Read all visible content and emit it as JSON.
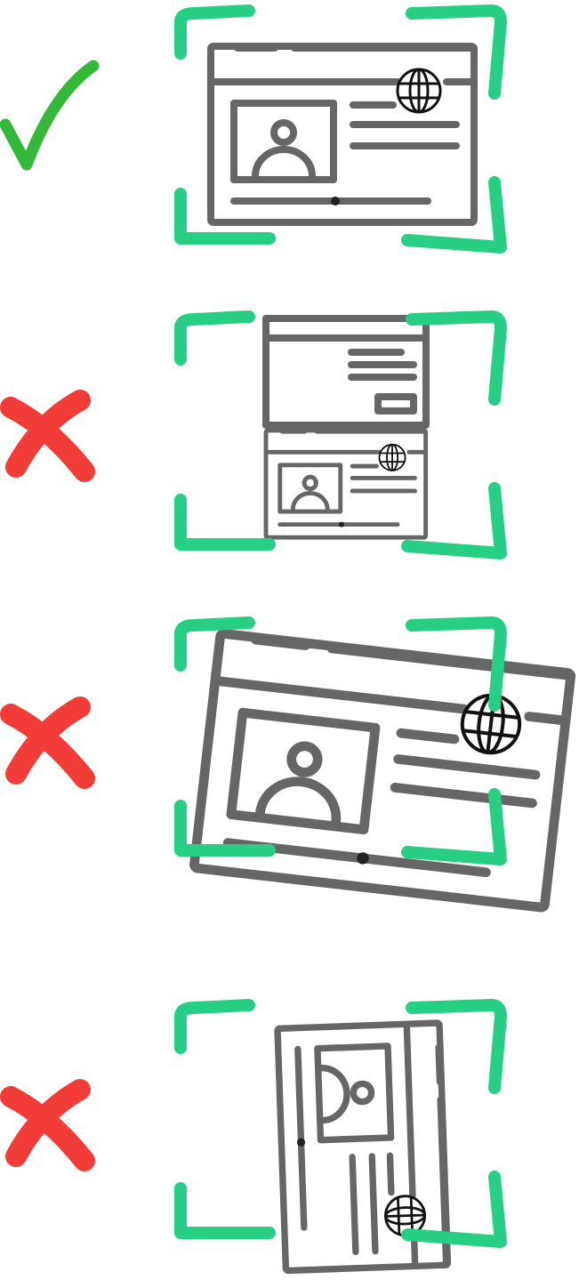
{
  "colors": {
    "frame": "#27cf84",
    "check": "#33b83a",
    "cross": "#f23c37",
    "card": "#666666",
    "globe": "#111111"
  },
  "examples": [
    {
      "status": "correct",
      "icon": "check-icon",
      "card": "id-card-straight-centered"
    },
    {
      "status": "incorrect",
      "icon": "cross-icon",
      "card": "id-card-two-sided-small"
    },
    {
      "status": "incorrect",
      "icon": "cross-icon",
      "card": "id-card-tilted-oversized"
    },
    {
      "status": "incorrect",
      "icon": "cross-icon",
      "card": "id-card-rotated-vertical"
    }
  ]
}
